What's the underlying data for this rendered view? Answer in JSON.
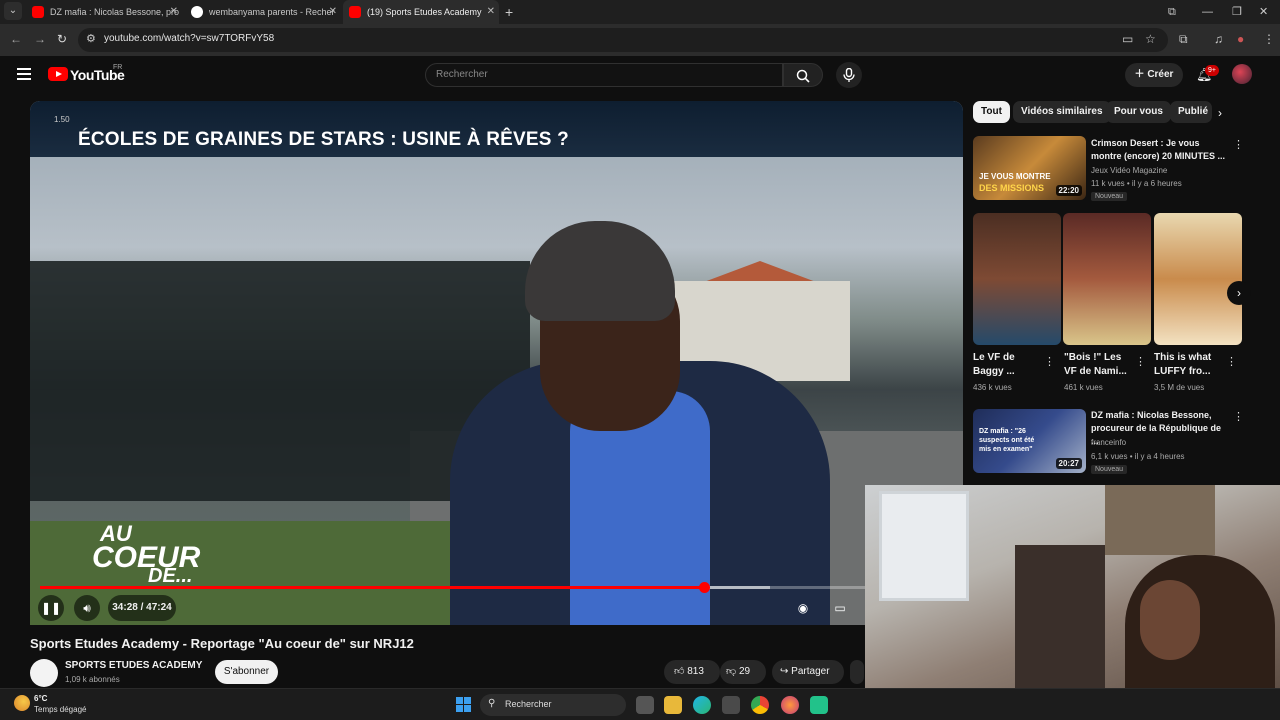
{
  "browser": {
    "tabs": [
      {
        "title": "DZ mafia : Nicolas Bessone, pro",
        "favicon": "youtube-icon"
      },
      {
        "title": "wembanyama parents - Recher",
        "favicon": "google-icon"
      },
      {
        "title": "(19) Sports Etudes Academy",
        "favicon": "youtube-icon"
      }
    ],
    "url": "youtube.com/watch?v=sw7TORFvY58"
  },
  "yt_header": {
    "logo": "YouTube",
    "country": "FR",
    "search_placeholder": "Rechercher",
    "create_label": "Créer",
    "notif_badge": "9+"
  },
  "player": {
    "overlay_title": "ÉCOLES DE GRAINES DE STARS : USINE À RÊVES ?",
    "overlay_timestamp": "1.50",
    "show_logo_line1": "AU",
    "show_logo_line2": "COEUR",
    "show_logo_line3": "DE...",
    "time": "34:28 / 47:24",
    "progress_fraction": 0.727,
    "buffered_fraction": 0.8
  },
  "video": {
    "title": "Sports Etudes Academy - Reportage \"Au coeur de\" sur NRJ12",
    "channel": "SPORTS ETUDES ACADEMY",
    "subscribers": "1,09 k abonnés",
    "subscribe_label": "S'abonner",
    "likes": "813",
    "dislikes": "29",
    "share_label": "Partager"
  },
  "sidebar": {
    "chips": [
      "Tout",
      "Vidéos similaires",
      "Pour vous",
      "Publié"
    ],
    "rec1": {
      "title": "Crimson Desert : Je vous montre (encore) 20 MINUTES ...",
      "channel": "Jeux Vidéo Magazine",
      "meta": "11 k vues • il y a 6 heures",
      "badge": "Nouveau",
      "duration": "22:20",
      "thumb_text1": "JE VOUS MONTRE",
      "thumb_text2": "DES MISSIONS"
    },
    "shorts": [
      {
        "title": "Le VF de Baggy ...",
        "views": "436 k vues"
      },
      {
        "title": "\"Bois !\" Les VF de Nami...",
        "views": "461 k vues"
      },
      {
        "title": "This is what LUFFY fro...",
        "views": "3,5 M de vues"
      }
    ],
    "rec2": {
      "title": "DZ mafia : Nicolas Bessone, procureur de la République de ...",
      "channel": "franceinfo",
      "meta": "6,1 k vues • il y a 4 heures",
      "badge": "Nouveau",
      "duration": "20:27",
      "thumb_text": "DZ mafia : \"26 suspects ont été mis en examen\""
    }
  },
  "taskbar": {
    "temp": "6°C",
    "weather": "Temps dégagé",
    "search_label": "Rechercher"
  }
}
